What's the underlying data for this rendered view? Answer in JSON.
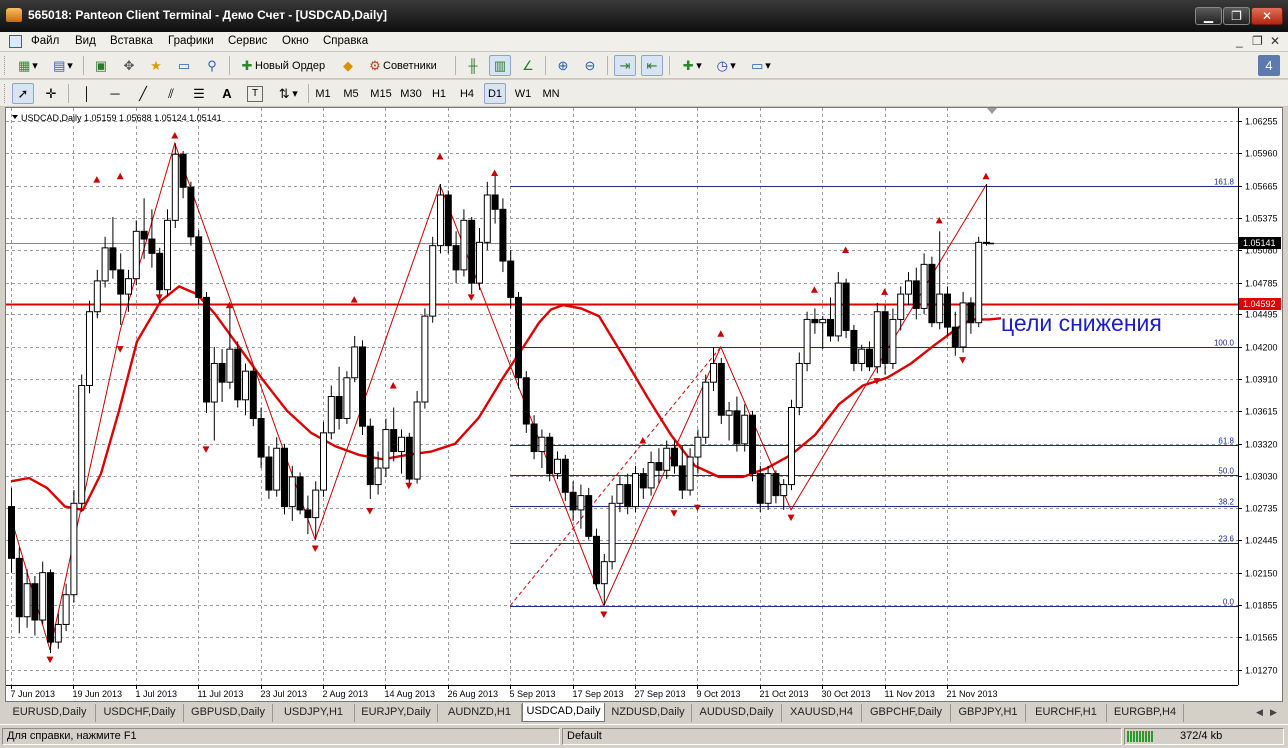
{
  "window": {
    "title": "565018: Panteon Client Terminal - Демо Счет - [USDCAD,Daily]",
    "minimize": "▁",
    "maximize": "❐",
    "close": "✕"
  },
  "menu": {
    "items": [
      "Файл",
      "Вид",
      "Вставка",
      "Графики",
      "Сервис",
      "Окно",
      "Справка"
    ],
    "mdi_minimize": "_",
    "mdi_restore": "❐",
    "mdi_close": "✕"
  },
  "toolbar1": {
    "new_order": "Новый Ордер",
    "experts": "Советники",
    "icons": [
      "new-chart-icon",
      "profiles-icon",
      "market-watch-icon",
      "navigator-icon",
      "favorites-icon",
      "terminal-icon",
      "strategy-tester-icon",
      "new-order-icon",
      "metaeditor-icon",
      "experts-icon",
      "bar-chart-icon",
      "candlestick-icon",
      "line-chart-icon",
      "zoom-in-icon",
      "zoom-out-icon",
      "autoscroll-icon",
      "chart-shift-icon",
      "indicators-icon",
      "periods-icon",
      "templates-icon"
    ]
  },
  "toolbar2": {
    "periods": [
      "M1",
      "M5",
      "M15",
      "M30",
      "H1",
      "H4",
      "D1",
      "W1",
      "MN"
    ],
    "active_period": "D1",
    "tools": [
      "cursor-icon",
      "crosshair-icon",
      "vertical-line-icon",
      "horizontal-line-icon",
      "trendline-icon",
      "fibonacci-channel-icon",
      "fibonacci-retracement-icon",
      "text-icon",
      "text-label-icon",
      "arrows-icon"
    ]
  },
  "chart": {
    "symbol_info": "USDCAD,Daily  1.05159 1.05688 1.05124 1.05141",
    "annotation": "цели снижения",
    "price_labels": {
      "current": "1.05141",
      "level": "1.04592"
    },
    "colors": {
      "bull_candle": "#ffffff",
      "bear_candle": "#000000",
      "moving_average": "#dd0000",
      "level_line": "#e00000",
      "fib_lines": "#1c2a8c",
      "zigzag": "#cc0000",
      "annotation": "#1c1cc8",
      "current_price_marker": "#000000"
    }
  },
  "chart_data": {
    "type": "candlestick",
    "symbol": "USDCAD",
    "timeframe": "Daily",
    "ohlc_header": {
      "open": 1.05159,
      "high": 1.05688,
      "low": 1.05124,
      "close": 1.05141
    },
    "y_ticks": [
      "1.06255",
      "1.05960",
      "1.05665",
      "1.05375",
      "1.05080",
      "1.04785",
      "1.04495",
      "1.04200",
      "1.03910",
      "1.03615",
      "1.03320",
      "1.03030",
      "1.02735",
      "1.02445",
      "1.02150",
      "1.01855",
      "1.01565",
      "1.01270"
    ],
    "ylim": [
      1.0113,
      1.0637
    ],
    "x_ticks": [
      "7 Jun 2013",
      "19 Jun 2013",
      "1 Jul 2013",
      "11 Jul 2013",
      "23 Jul 2013",
      "2 Aug 2013",
      "14 Aug 2013",
      "26 Aug 2013",
      "5 Sep 2013",
      "17 Sep 2013",
      "27 Sep 2013",
      "9 Oct 2013",
      "21 Oct 2013",
      "30 Oct 2013",
      "11 Nov 2013",
      "21 Nov 2013"
    ],
    "x_tick_bar_index": [
      0,
      8,
      16,
      24,
      32,
      40,
      48,
      56,
      64,
      72,
      80,
      88,
      96,
      104,
      112,
      120
    ],
    "fib_levels": [
      {
        "label": "161.8",
        "price": 1.05665
      },
      {
        "label": "100.0",
        "price": 1.042
      },
      {
        "label": "61.8",
        "price": 1.0331
      },
      {
        "label": "50.0",
        "price": 1.03035
      },
      {
        "label": "38.2",
        "price": 1.0276
      },
      {
        "label": "23.6",
        "price": 1.0242
      },
      {
        "label": "0.0",
        "price": 1.0185
      }
    ],
    "fib_start_bar": 64,
    "horizontal_level": 1.04592,
    "current_price": 1.05141,
    "zigzag_pivots": [
      {
        "bar": 0,
        "price": 1.0265
      },
      {
        "bar": 5,
        "price": 1.0145
      },
      {
        "bar": 14,
        "price": 1.0435
      },
      {
        "bar": 21,
        "price": 1.0605
      },
      {
        "bar": 39,
        "price": 1.0245
      },
      {
        "bar": 55,
        "price": 1.0567
      },
      {
        "bar": 76,
        "price": 1.0185
      },
      {
        "bar": 91,
        "price": 1.042
      },
      {
        "bar": 100,
        "price": 1.0272
      },
      {
        "bar": 125,
        "price": 1.0567
      }
    ],
    "dashed_trend": [
      {
        "bar": 64,
        "price": 1.0185
      },
      {
        "bar": 91,
        "price": 1.042
      }
    ],
    "fractals_up": [
      {
        "bar": 11,
        "price": 1.0572
      },
      {
        "bar": 14,
        "price": 1.0575
      },
      {
        "bar": 21,
        "price": 1.0612
      },
      {
        "bar": 28,
        "price": 1.0458
      },
      {
        "bar": 44,
        "price": 1.0463
      },
      {
        "bar": 49,
        "price": 1.0385
      },
      {
        "bar": 55,
        "price": 1.0593
      },
      {
        "bar": 62,
        "price": 1.0578
      },
      {
        "bar": 81,
        "price": 1.0335
      },
      {
        "bar": 91,
        "price": 1.0432
      },
      {
        "bar": 103,
        "price": 1.0472
      },
      {
        "bar": 107,
        "price": 1.0508
      },
      {
        "bar": 112,
        "price": 1.047
      },
      {
        "bar": 119,
        "price": 1.0535
      },
      {
        "bar": 125,
        "price": 1.0575
      }
    ],
    "fractals_down": [
      {
        "bar": 5,
        "price": 1.0136
      },
      {
        "bar": 14,
        "price": 1.0418
      },
      {
        "bar": 19,
        "price": 1.0465
      },
      {
        "bar": 25,
        "price": 1.0327
      },
      {
        "bar": 39,
        "price": 1.0237
      },
      {
        "bar": 46,
        "price": 1.0271
      },
      {
        "bar": 51,
        "price": 1.0294
      },
      {
        "bar": 59,
        "price": 1.0465
      },
      {
        "bar": 76,
        "price": 1.0177
      },
      {
        "bar": 85,
        "price": 1.0269
      },
      {
        "bar": 88,
        "price": 1.0274
      },
      {
        "bar": 100,
        "price": 1.0265
      },
      {
        "bar": 111,
        "price": 1.0389
      },
      {
        "bar": 122,
        "price": 1.0408
      }
    ],
    "ohlc": [
      [
        1.0275,
        1.0292,
        1.0215,
        1.0228
      ],
      [
        1.0228,
        1.0238,
        1.016,
        1.0175
      ],
      [
        1.0175,
        1.0218,
        1.0165,
        1.0205
      ],
      [
        1.0205,
        1.0212,
        1.0158,
        1.0172
      ],
      [
        1.0172,
        1.0225,
        1.0168,
        1.0215
      ],
      [
        1.0215,
        1.0218,
        1.0142,
        1.0152
      ],
      [
        1.0152,
        1.0178,
        1.0146,
        1.0168
      ],
      [
        1.0168,
        1.0205,
        1.0162,
        1.0195
      ],
      [
        1.0195,
        1.029,
        1.0188,
        1.0278
      ],
      [
        1.0278,
        1.0395,
        1.027,
        1.0385
      ],
      [
        1.0385,
        1.0462,
        1.0378,
        1.0452
      ],
      [
        1.0452,
        1.049,
        1.0446,
        1.048
      ],
      [
        1.048,
        1.052,
        1.0474,
        1.051
      ],
      [
        1.051,
        1.0538,
        1.0482,
        1.049
      ],
      [
        1.049,
        1.0505,
        1.044,
        1.0468
      ],
      [
        1.0468,
        1.049,
        1.0452,
        1.0482
      ],
      [
        1.0482,
        1.0535,
        1.0476,
        1.0525
      ],
      [
        1.0525,
        1.0555,
        1.05,
        1.0518
      ],
      [
        1.0518,
        1.0545,
        1.0492,
        1.0505
      ],
      [
        1.0505,
        1.051,
        1.046,
        1.0472
      ],
      [
        1.0472,
        1.0545,
        1.0466,
        1.0535
      ],
      [
        1.0535,
        1.0605,
        1.0528,
        1.0595
      ],
      [
        1.0595,
        1.0598,
        1.0555,
        1.0565
      ],
      [
        1.0565,
        1.057,
        1.0512,
        1.052
      ],
      [
        1.052,
        1.0526,
        1.0458,
        1.0465
      ],
      [
        1.0465,
        1.047,
        1.036,
        1.037
      ],
      [
        1.037,
        1.042,
        1.0335,
        1.0405
      ],
      [
        1.0405,
        1.0418,
        1.037,
        1.0388
      ],
      [
        1.0388,
        1.0458,
        1.0382,
        1.0418
      ],
      [
        1.0418,
        1.0425,
        1.0365,
        1.0372
      ],
      [
        1.0372,
        1.0405,
        1.0358,
        1.0398
      ],
      [
        1.0398,
        1.0402,
        1.0348,
        1.0355
      ],
      [
        1.0355,
        1.0365,
        1.031,
        1.032
      ],
      [
        1.032,
        1.033,
        1.0282,
        1.029
      ],
      [
        1.029,
        1.0338,
        1.0284,
        1.0328
      ],
      [
        1.0328,
        1.0332,
        1.0268,
        1.0275
      ],
      [
        1.0275,
        1.0312,
        1.0262,
        1.0302
      ],
      [
        1.0302,
        1.0306,
        1.0268,
        1.0272
      ],
      [
        1.0272,
        1.0285,
        1.025,
        1.0265
      ],
      [
        1.0265,
        1.0298,
        1.0245,
        1.029
      ],
      [
        1.029,
        1.0352,
        1.0284,
        1.0342
      ],
      [
        1.0342,
        1.0385,
        1.0336,
        1.0375
      ],
      [
        1.0375,
        1.0402,
        1.0345,
        1.0355
      ],
      [
        1.0355,
        1.0398,
        1.035,
        1.0392
      ],
      [
        1.0392,
        1.043,
        1.0388,
        1.042
      ],
      [
        1.042,
        1.0426,
        1.034,
        1.0348
      ],
      [
        1.0348,
        1.0355,
        1.0282,
        1.0295
      ],
      [
        1.0295,
        1.0325,
        1.0286,
        1.031
      ],
      [
        1.031,
        1.0355,
        1.0302,
        1.0345
      ],
      [
        1.0345,
        1.0365,
        1.0316,
        1.0325
      ],
      [
        1.0325,
        1.0345,
        1.0305,
        1.0338
      ],
      [
        1.0338,
        1.0342,
        1.0295,
        1.03
      ],
      [
        1.03,
        1.038,
        1.0296,
        1.037
      ],
      [
        1.037,
        1.0455,
        1.0364,
        1.0448
      ],
      [
        1.0448,
        1.052,
        1.0442,
        1.0512
      ],
      [
        1.0512,
        1.0568,
        1.0505,
        1.0558
      ],
      [
        1.0558,
        1.0562,
        1.0505,
        1.0512
      ],
      [
        1.0512,
        1.0525,
        1.0478,
        1.049
      ],
      [
        1.049,
        1.0545,
        1.0484,
        1.0535
      ],
      [
        1.0535,
        1.0538,
        1.0468,
        1.0478
      ],
      [
        1.0478,
        1.0528,
        1.0472,
        1.0515
      ],
      [
        1.0515,
        1.057,
        1.0508,
        1.0558
      ],
      [
        1.0558,
        1.0578,
        1.0532,
        1.0545
      ],
      [
        1.0545,
        1.0555,
        1.0488,
        1.0498
      ],
      [
        1.0498,
        1.0508,
        1.0455,
        1.0465
      ],
      [
        1.0465,
        1.047,
        1.0382,
        1.0392
      ],
      [
        1.0392,
        1.0398,
        1.0342,
        1.035
      ],
      [
        1.035,
        1.0358,
        1.0318,
        1.0325
      ],
      [
        1.0325,
        1.0345,
        1.031,
        1.0338
      ],
      [
        1.0338,
        1.0342,
        1.0298,
        1.0305
      ],
      [
        1.0305,
        1.0325,
        1.03,
        1.0318
      ],
      [
        1.0318,
        1.0322,
        1.028,
        1.0288
      ],
      [
        1.0288,
        1.0298,
        1.0262,
        1.0272
      ],
      [
        1.0272,
        1.0295,
        1.0255,
        1.0285
      ],
      [
        1.0285,
        1.0292,
        1.0245,
        1.0248
      ],
      [
        1.0248,
        1.0255,
        1.02,
        1.0205
      ],
      [
        1.0205,
        1.0232,
        1.0185,
        1.0225
      ],
      [
        1.0225,
        1.0285,
        1.0218,
        1.0278
      ],
      [
        1.0278,
        1.0302,
        1.027,
        1.0295
      ],
      [
        1.0295,
        1.0305,
        1.0268,
        1.0275
      ],
      [
        1.0275,
        1.0312,
        1.027,
        1.0305
      ],
      [
        1.0305,
        1.031,
        1.0282,
        1.0292
      ],
      [
        1.0292,
        1.0325,
        1.0285,
        1.0315
      ],
      [
        1.0315,
        1.0328,
        1.0296,
        1.0308
      ],
      [
        1.0308,
        1.0335,
        1.03,
        1.0328
      ],
      [
        1.0328,
        1.0335,
        1.0305,
        1.0312
      ],
      [
        1.0312,
        1.033,
        1.0282,
        1.029
      ],
      [
        1.029,
        1.0328,
        1.0285,
        1.032
      ],
      [
        1.032,
        1.0345,
        1.0305,
        1.0338
      ],
      [
        1.0338,
        1.0395,
        1.0332,
        1.0388
      ],
      [
        1.0388,
        1.042,
        1.038,
        1.0405
      ],
      [
        1.0405,
        1.041,
        1.035,
        1.0358
      ],
      [
        1.0358,
        1.037,
        1.0335,
        1.0362
      ],
      [
        1.0362,
        1.0375,
        1.0325,
        1.0332
      ],
      [
        1.0332,
        1.0368,
        1.0325,
        1.0358
      ],
      [
        1.0358,
        1.0362,
        1.0298,
        1.0305
      ],
      [
        1.0305,
        1.0312,
        1.027,
        1.0278
      ],
      [
        1.0278,
        1.0312,
        1.0272,
        1.0305
      ],
      [
        1.0305,
        1.0308,
        1.0278,
        1.0285
      ],
      [
        1.0285,
        1.03,
        1.0272,
        1.0295
      ],
      [
        1.0295,
        1.0372,
        1.029,
        1.0365
      ],
      [
        1.0365,
        1.0415,
        1.0358,
        1.0405
      ],
      [
        1.0405,
        1.0452,
        1.0398,
        1.0445
      ],
      [
        1.0445,
        1.0455,
        1.0432,
        1.0442
      ],
      [
        1.0442,
        1.0448,
        1.0418,
        1.0445
      ],
      [
        1.0445,
        1.0465,
        1.0425,
        1.043
      ],
      [
        1.043,
        1.0488,
        1.0425,
        1.0478
      ],
      [
        1.0478,
        1.0482,
        1.0428,
        1.0435
      ],
      [
        1.0435,
        1.044,
        1.0398,
        1.0405
      ],
      [
        1.0405,
        1.0422,
        1.0398,
        1.0418
      ],
      [
        1.0418,
        1.0425,
        1.0398,
        1.0402
      ],
      [
        1.0402,
        1.046,
        1.0396,
        1.0452
      ],
      [
        1.0452,
        1.0458,
        1.0395,
        1.0405
      ],
      [
        1.0405,
        1.0455,
        1.04,
        1.0445
      ],
      [
        1.0445,
        1.0475,
        1.0435,
        1.0468
      ],
      [
        1.0468,
        1.0488,
        1.0458,
        1.048
      ],
      [
        1.048,
        1.0492,
        1.0445,
        1.0455
      ],
      [
        1.0455,
        1.0505,
        1.045,
        1.0495
      ],
      [
        1.0495,
        1.0502,
        1.0438,
        1.0442
      ],
      [
        1.0442,
        1.0525,
        1.0436,
        1.0468
      ],
      [
        1.0468,
        1.0475,
        1.043,
        1.0438
      ],
      [
        1.0438,
        1.0452,
        1.0412,
        1.042
      ],
      [
        1.042,
        1.047,
        1.0415,
        1.046
      ],
      [
        1.046,
        1.0465,
        1.0432,
        1.0442
      ],
      [
        1.0442,
        1.052,
        1.0438,
        1.0515
      ],
      [
        1.0515,
        1.0568,
        1.0512,
        1.0514
      ]
    ],
    "ma": [
      [
        0,
        1.0298
      ],
      [
        3,
        1.0301
      ],
      [
        6,
        1.0292
      ],
      [
        9,
        1.0275
      ],
      [
        12,
        1.0272
      ],
      [
        15,
        1.0305
      ],
      [
        18,
        1.0362
      ],
      [
        21,
        1.0425
      ],
      [
        25,
        1.0462
      ],
      [
        28,
        1.0475
      ],
      [
        31,
        1.0468
      ],
      [
        34,
        1.045
      ],
      [
        38,
        1.042
      ],
      [
        42,
        1.039
      ],
      [
        46,
        1.0362
      ],
      [
        50,
        1.0342
      ],
      [
        54,
        1.033
      ],
      [
        58,
        1.0322
      ],
      [
        62,
        1.0318
      ],
      [
        66,
        1.0322
      ],
      [
        70,
        1.0325
      ],
      [
        74,
        1.0332
      ],
      [
        78,
        1.0356
      ],
      [
        82,
        1.0392
      ],
      [
        86,
        1.0425
      ],
      [
        88,
        1.0442
      ],
      [
        90,
        1.0454
      ],
      [
        92,
        1.0458
      ],
      [
        95,
        1.0455
      ],
      [
        98,
        1.0448
      ],
      [
        102,
        1.0412
      ],
      [
        106,
        1.0375
      ],
      [
        110,
        1.034
      ],
      [
        114,
        1.0312
      ],
      [
        118,
        1.0302
      ],
      [
        122,
        1.0302
      ],
      [
        126,
        1.031
      ],
      [
        130,
        1.0322
      ],
      [
        134,
        1.034
      ],
      [
        138,
        1.0368
      ],
      [
        142,
        1.0385
      ],
      [
        146,
        1.0392
      ],
      [
        150,
        1.0405
      ],
      [
        154,
        1.0422
      ],
      [
        158,
        1.0438
      ],
      [
        160,
        1.0445
      ],
      [
        163,
        1.0445
      ],
      [
        165,
        1.0446
      ]
    ],
    "ma_px_x_note": "",
    "ma_bar_scale": 0.7692
  },
  "tabs": {
    "items": [
      "EURUSD,Daily",
      "USDCHF,Daily",
      "GBPUSD,Daily",
      "USDJPY,H1",
      "EURJPY,Daily",
      "AUDNZD,H1",
      "USDCAD,Daily",
      "NZDUSD,Daily",
      "AUDUSD,Daily",
      "XAUUSD,H4",
      "GBPCHF,Daily",
      "GBPJPY,H1",
      "EURCHF,H1",
      "EURGBP,H4"
    ],
    "active_index": 6
  },
  "status": {
    "help": "Для справки, нажмите F1",
    "profile": "Default",
    "traffic": "372/4 kb"
  }
}
